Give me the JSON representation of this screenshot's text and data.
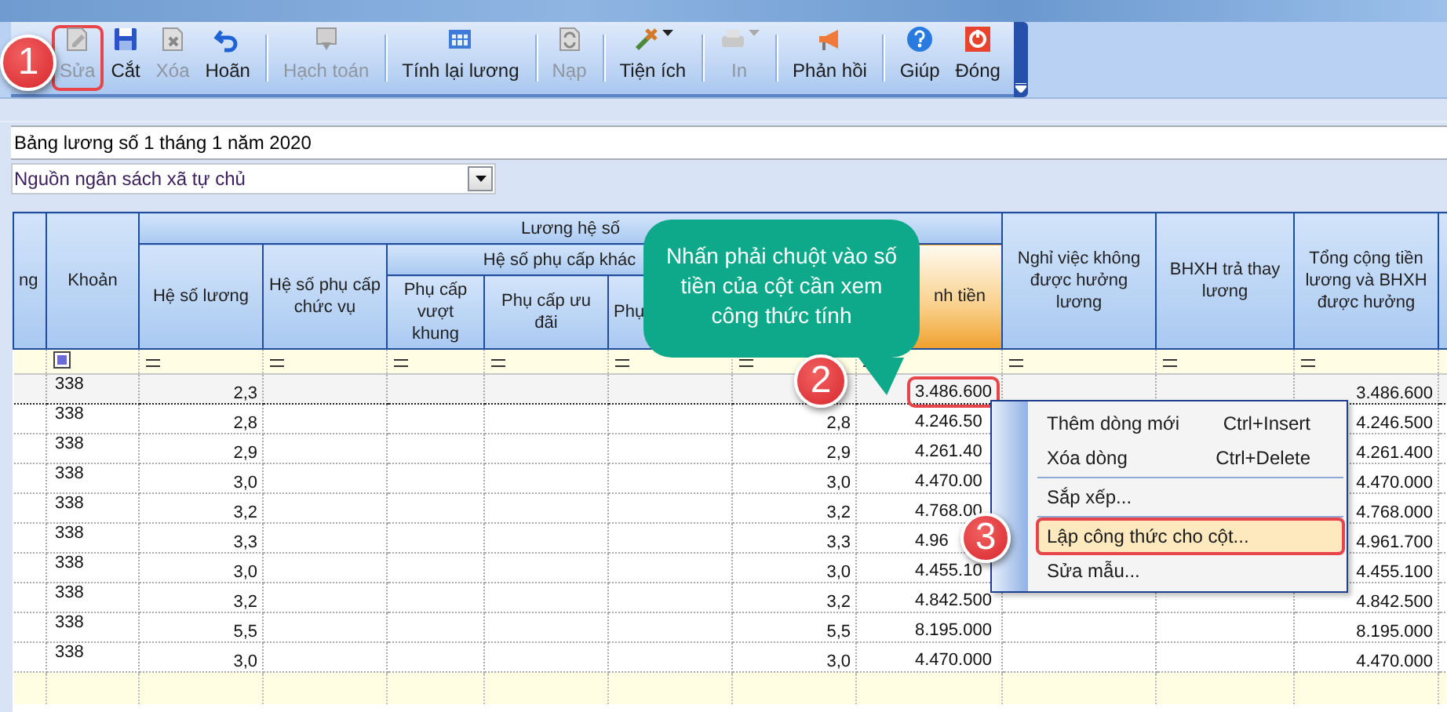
{
  "toolbar": {
    "groups": [
      [
        {
          "label": "Sửa",
          "disabled": true,
          "dropdown": false,
          "annotated": true
        },
        {
          "label": "Cắt",
          "disabled": false,
          "dropdown": false,
          "annotated": false
        },
        {
          "label": "Xóa",
          "disabled": true,
          "dropdown": false,
          "annotated": false
        },
        {
          "label": "Hoãn",
          "disabled": false,
          "dropdown": false,
          "annotated": false
        }
      ],
      [
        {
          "label": "Hạch toán",
          "disabled": true,
          "dropdown": false,
          "annotated": false
        }
      ],
      [
        {
          "label": "Tính lại lương",
          "disabled": false,
          "dropdown": false,
          "annotated": false
        }
      ],
      [
        {
          "label": "Nạp",
          "disabled": true,
          "dropdown": false,
          "annotated": false
        }
      ],
      [
        {
          "label": "Tiện ích",
          "disabled": false,
          "dropdown": true,
          "annotated": false
        }
      ],
      [
        {
          "label": "In",
          "disabled": true,
          "dropdown": true,
          "annotated": false
        }
      ],
      [
        {
          "label": "Phản hồi",
          "disabled": false,
          "dropdown": false,
          "annotated": false
        }
      ],
      [
        {
          "label": "Giúp",
          "disabled": false,
          "dropdown": false,
          "annotated": false
        },
        {
          "label": "Đóng",
          "disabled": false,
          "dropdown": false,
          "annotated": false
        }
      ]
    ]
  },
  "payroll_title": "Bảng lương số 1 tháng 1 năm 2020",
  "funding_source": {
    "value": "Nguồn ngân sách xã tự chủ"
  },
  "grid": {
    "headers": {
      "column_1": "ng",
      "khoan": "Khoản",
      "luong_he_so": "Lương hệ số",
      "he_so_luong": "Hệ số lương",
      "he_so_phu_cap_chuc_vu": "Hệ số phụ cấp chức vụ",
      "he_so_phu_cap_khac": "Hệ số phụ cấp khác",
      "phu_cap_vuot_khung": "Phụ cấp vượt khung",
      "phu_cap_uu_dai": "Phụ cấp ưu đãi",
      "column_7": "Phụ",
      "thanh_tien": "nh tiền",
      "nghi_viec": "Nghỉ việc không được hưởng lương",
      "bhxh": "BHXH trả thay lương",
      "tong": "Tổng cộng tiền lương và BHXH được hưởng"
    },
    "rows": [
      {
        "selected": true,
        "khoan": "338",
        "he_so_luong": "2,3",
        "thanh_tien": "3.486.600",
        "thanh_tien_annotated": true,
        "tong": "3.486.600"
      },
      {
        "selected": false,
        "khoan": "338",
        "he_so_luong": "2,8",
        "column_8": "2,8",
        "thanh_tien": "4.246.50",
        "thanh_tien_annotated": false,
        "tong": "4.246.500"
      },
      {
        "selected": false,
        "khoan": "338",
        "he_so_luong": "2,9",
        "column_8": "2,9",
        "thanh_tien": "4.261.40",
        "thanh_tien_annotated": false,
        "tong": "4.261.400"
      },
      {
        "selected": false,
        "khoan": "338",
        "he_so_luong": "3,0",
        "column_8": "3,0",
        "thanh_tien": "4.470.00",
        "thanh_tien_annotated": false,
        "tong": "4.470.000"
      },
      {
        "selected": false,
        "khoan": "338",
        "he_so_luong": "3,2",
        "column_8": "3,2",
        "thanh_tien": "4.768.00",
        "thanh_tien_annotated": false,
        "tong": "4.768.000"
      },
      {
        "selected": false,
        "khoan": "338",
        "he_so_luong": "3,3",
        "column_8": "3,3",
        "thanh_tien": "4.96",
        "thanh_tien_annotated": false,
        "tong": "4.961.700"
      },
      {
        "selected": false,
        "khoan": "338",
        "he_so_luong": "3,0",
        "column_8": "3,0",
        "thanh_tien": "4.455.10",
        "thanh_tien_annotated": false,
        "tong": "4.455.100"
      },
      {
        "selected": false,
        "khoan": "338",
        "he_so_luong": "3,2",
        "column_8": "3,2",
        "thanh_tien": "4.842.500",
        "thanh_tien_annotated": false,
        "tong": "4.842.500"
      },
      {
        "selected": false,
        "khoan": "338",
        "he_so_luong": "5,5",
        "column_8": "5,5",
        "thanh_tien": "8.195.000",
        "thanh_tien_annotated": false,
        "tong": "8.195.000"
      },
      {
        "selected": false,
        "khoan": "338",
        "he_so_luong": "3,0",
        "column_8": "3,0",
        "thanh_tien": "4.470.000",
        "thanh_tien_annotated": false,
        "tong": "4.470.000"
      }
    ]
  },
  "callout": {
    "text": "Nhấn phải chuột vào số tiền của cột cần xem công thức tính"
  },
  "context_menu": {
    "items": [
      {
        "label": "Thêm dòng mới",
        "shortcut": "Ctrl+Insert",
        "selected": false,
        "annotated": false,
        "separator_after": false
      },
      {
        "label": "Xóa dòng",
        "shortcut": "Ctrl+Delete",
        "selected": false,
        "annotated": false,
        "separator_after": true
      },
      {
        "label": "Sắp xếp...",
        "selected": false,
        "annotated": false,
        "separator_after": true
      },
      {
        "label": "Lập công thức cho cột...",
        "selected": true,
        "annotated": true,
        "separator_after": false
      },
      {
        "label": "Sửa mẫu...",
        "selected": false,
        "annotated": false,
        "separator_after": false
      }
    ]
  },
  "step_badges": [
    "1",
    "2",
    "3"
  ]
}
